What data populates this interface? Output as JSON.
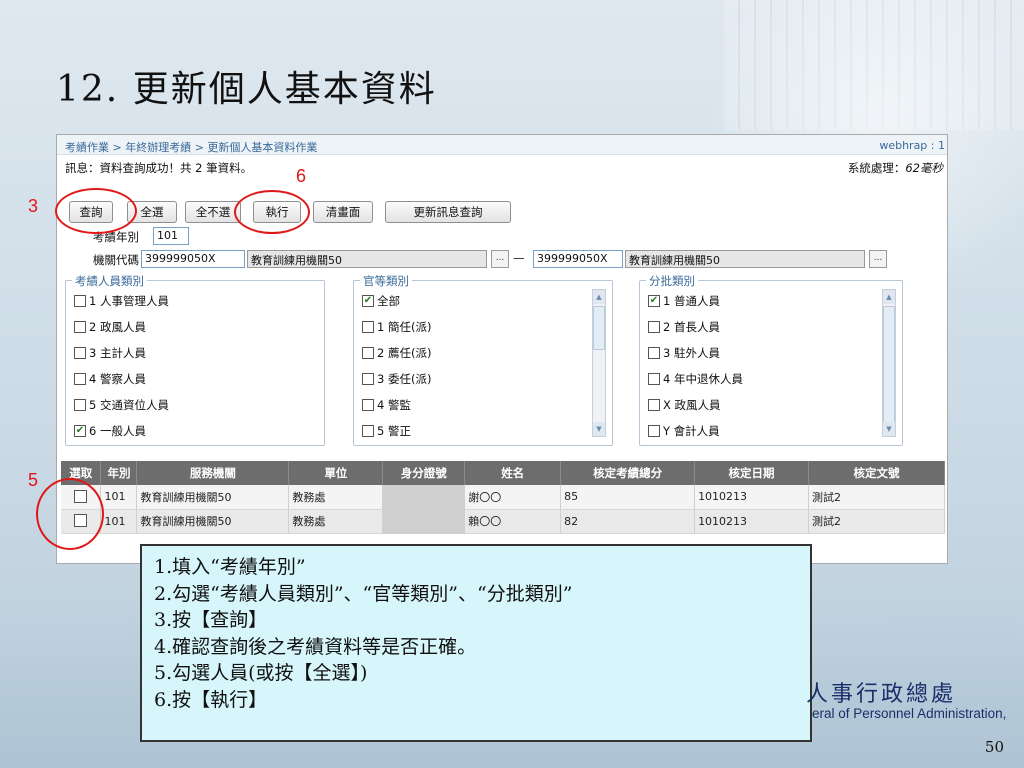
{
  "slide": {
    "title": "12. 更新個人基本資料",
    "page_number": "50",
    "org_name_zh": "人事行政總處",
    "org_name_en": "eral of Personnel Administration,"
  },
  "app": {
    "breadcrumb": "考績作業 > 年終辦理考績 > 更新個人基本資料作業",
    "user": "webhrap : 1",
    "message": "訊息：資料查詢成功！共 2 筆資料。",
    "system_time_label": "系統處理：",
    "system_time_value": "62毫秒",
    "buttons": {
      "query": "查詢",
      "select_all": "全選",
      "deselect_all": "全不選",
      "execute": "執行",
      "clear": "清畫面",
      "update_msg_query": "更新訊息查詢"
    },
    "fields": {
      "year_label": "考績年別",
      "year_value": "101",
      "org_code_label": "機關代碼",
      "org_code_from": "399999050X",
      "org_name_from": "教育訓練用機關50",
      "org_code_to": "399999050X",
      "org_name_to": "教育訓練用機關50",
      "range_dash": "—",
      "browse": "..."
    },
    "groups": {
      "personnel": {
        "title": "考績人員類別",
        "items": [
          {
            "label": "1 人事管理人員",
            "checked": false
          },
          {
            "label": "2 政風人員",
            "checked": false
          },
          {
            "label": "3 主計人員",
            "checked": false
          },
          {
            "label": "4 警察人員",
            "checked": false
          },
          {
            "label": "5 交通資位人員",
            "checked": false
          },
          {
            "label": "6 一般人員",
            "checked": true
          }
        ]
      },
      "rank": {
        "title": "官等類別",
        "items": [
          {
            "label": "全部",
            "checked": true
          },
          {
            "label": "1 簡任(派)",
            "checked": false
          },
          {
            "label": "2 薦任(派)",
            "checked": false
          },
          {
            "label": "3 委任(派)",
            "checked": false
          },
          {
            "label": "4 警監",
            "checked": false
          },
          {
            "label": "5 警正",
            "checked": false
          }
        ]
      },
      "batch": {
        "title": "分批類別",
        "items": [
          {
            "label": "1 普通人員",
            "checked": true
          },
          {
            "label": "2 首長人員",
            "checked": false
          },
          {
            "label": "3 駐外人員",
            "checked": false
          },
          {
            "label": "4 年中退休人員",
            "checked": false
          },
          {
            "label": "X 政風人員",
            "checked": false
          },
          {
            "label": "Y 會計人員",
            "checked": false
          }
        ]
      }
    },
    "table": {
      "headers": [
        "選取",
        "年別",
        "服務機關",
        "單位",
        "身分證號",
        "姓名",
        "核定考績總分",
        "核定日期",
        "核定文號"
      ],
      "rows": [
        [
          "",
          "101",
          "教育訓練用機關50",
          "教務處",
          "",
          "謝〇〇",
          "85",
          "1010213",
          "測試2"
        ],
        [
          "",
          "101",
          "教育訓練用機關50",
          "教務處",
          "",
          "賴〇〇",
          "82",
          "1010213",
          "測試2"
        ]
      ]
    }
  },
  "annotations": {
    "step3": "3",
    "step5": "5",
    "step6": "6",
    "circle_color": "#e01818"
  },
  "instructions": [
    "1.填入“考績年別”",
    "2.勾選“考績人員類別”、“官等類別”、“分批類別”",
    "3.按【查詢】",
    "4.確認查詢後之考績資料等是否正確。",
    "5.勾選人員(或按【全選】)",
    "6.按【執行】"
  ]
}
